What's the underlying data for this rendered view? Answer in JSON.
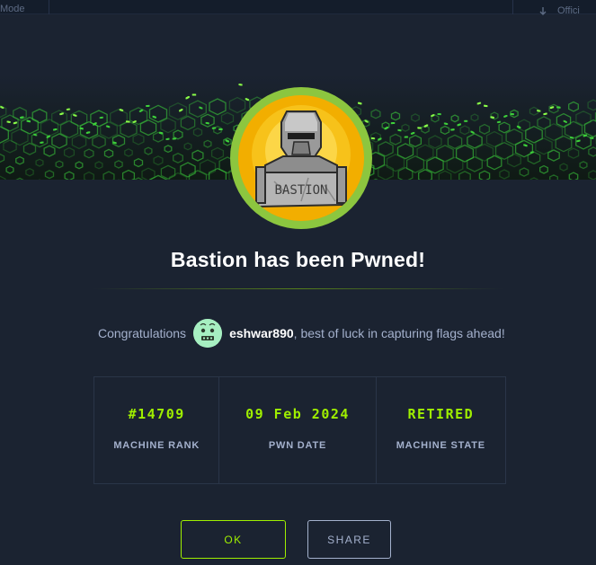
{
  "background_page": {
    "mode_label": "Mode",
    "official_label": "Offici"
  },
  "modal": {
    "title": "Bastion has been Pwned!",
    "machine_name": "BASTION",
    "congrats": {
      "prefix": "Congratulations",
      "username": "eshwar890",
      "suffix": ", best of luck in capturing flags ahead!"
    },
    "stats": [
      {
        "value": "#14709",
        "label": "MACHINE RANK"
      },
      {
        "value": "09 Feb 2024",
        "label": "PWN DATE"
      },
      {
        "value": "RETIRED",
        "label": "MACHINE STATE"
      }
    ],
    "buttons": {
      "ok_label": "OK",
      "share_label": "SHARE"
    }
  },
  "colors": {
    "background": "#1b2331",
    "accent": "#9fef00",
    "text": "#a4b1cd",
    "avatar_ring": "#8cc63f"
  },
  "icons": [
    "machine-avatar-icon",
    "user-avatar-icon",
    "download-icon"
  ]
}
